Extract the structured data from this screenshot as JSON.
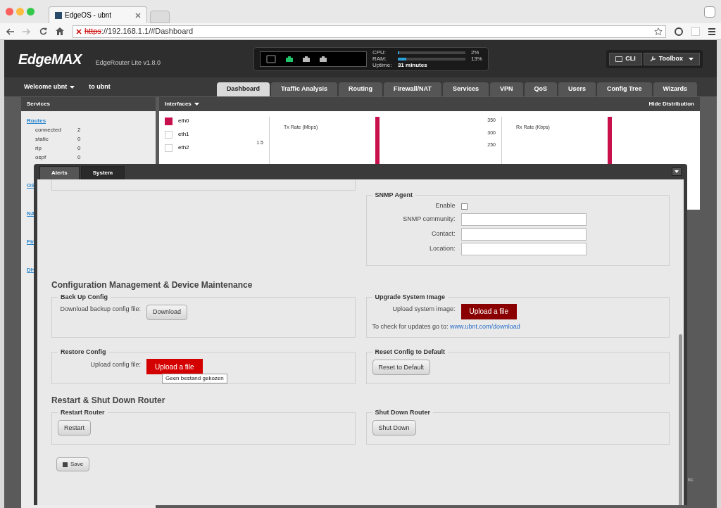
{
  "browser": {
    "tab_title": "EdgeOS - ubnt",
    "url_scheme": "https",
    "url_rest": "://192.168.1.1/#Dashboard"
  },
  "header": {
    "logo": "EdgeMAX",
    "model": "EdgeRouter Lite v1.8.0",
    "ports": [
      {
        "kind": "console",
        "active": false
      },
      {
        "kind": "ethernet",
        "active": true
      },
      {
        "kind": "ethernet",
        "active": false
      },
      {
        "kind": "ethernet",
        "active": false
      }
    ],
    "meters": [
      {
        "label": "CPU:",
        "level": 0.02,
        "reading": "2%"
      },
      {
        "label": "RAM:",
        "level": 0.13,
        "reading": "13%"
      }
    ],
    "uptime": {
      "label": "Uptime:",
      "value": "31 minutes"
    },
    "buttons": [
      {
        "kind": "terminal",
        "label": "CLI"
      },
      {
        "kind": "wrench",
        "label": "Toolbox",
        "menu": true
      }
    ]
  },
  "user_menu": {
    "welcome": "Welcome ubnt",
    "device": "to ubnt"
  },
  "tabs": [
    {
      "label": "Dashboard",
      "selected": true
    },
    {
      "label": "Traffic Analysis",
      "selected": false
    },
    {
      "label": "Routing",
      "selected": false
    },
    {
      "label": "Firewall/NAT",
      "selected": false
    },
    {
      "label": "Services",
      "selected": false
    },
    {
      "label": "VPN",
      "selected": false
    },
    {
      "label": "QoS",
      "selected": false
    },
    {
      "label": "Users",
      "selected": false
    },
    {
      "label": "Config Tree",
      "selected": false
    },
    {
      "label": "Wizards",
      "selected": false
    }
  ],
  "services": {
    "title": "Services",
    "link": "Routes",
    "rows": [
      {
        "name": "connected",
        "value": "2"
      },
      {
        "name": "static",
        "value": "0"
      },
      {
        "name": "rip",
        "value": "0"
      },
      {
        "name": "ospf",
        "value": "0"
      }
    ],
    "more_links": [
      "OS",
      "NA",
      "Fir",
      "DH"
    ]
  },
  "interfaces": {
    "title": "Interfaces",
    "action": "Hide Distribution",
    "items": [
      {
        "name": "eth0",
        "checked": true
      },
      {
        "name": "eth1",
        "checked": false
      },
      {
        "name": "eth2",
        "checked": false
      }
    ],
    "charts": [
      {
        "title": "Tx Rate (Mbps)",
        "ticks": [
          "1.5"
        ]
      },
      {
        "title": "Rx Rate (Kbps)",
        "ticks": [
          "350",
          "300",
          "250"
        ]
      }
    ]
  },
  "footer_fragment": "nc.",
  "panel": {
    "tabs": [
      {
        "label": "Alerts",
        "selected": false
      },
      {
        "label": "System",
        "selected": true
      }
    ],
    "snmp": {
      "title": "SNMP Agent",
      "enable_label": "Enable",
      "enabled": false,
      "fields": [
        {
          "label": "SNMP community:"
        },
        {
          "label": "Contact:"
        },
        {
          "label": "Location:"
        }
      ]
    },
    "sections": [
      {
        "heading": "Configuration Management & Device Maintenance",
        "groups": [
          {
            "title": "Back Up Config",
            "label": "Download backup config file:",
            "button": {
              "kind": "plain",
              "label": "Download"
            }
          },
          {
            "title": "Upgrade System Image",
            "label": "Upload system image:",
            "button": {
              "kind": "upload-dark",
              "label": "Upload a file"
            },
            "note": "To check for updates go to:",
            "link": "www.ubnt.com/download"
          },
          {
            "title": "Restore Config",
            "label": "Upload config file:",
            "button": {
              "kind": "upload",
              "label": "Upload a file"
            },
            "tooltip": "Geen bestand gekozen"
          },
          {
            "title": "Reset Config to Default",
            "button": {
              "kind": "plain",
              "label": "Reset to Default"
            }
          }
        ]
      },
      {
        "heading": "Restart & Shut Down Router",
        "groups": [
          {
            "title": "Restart Router",
            "button": {
              "kind": "plain",
              "label": "Restart"
            }
          },
          {
            "title": "Shut Down Router",
            "button": {
              "kind": "plain",
              "label": "Shut Down"
            }
          }
        ]
      }
    ],
    "save": "Save"
  }
}
